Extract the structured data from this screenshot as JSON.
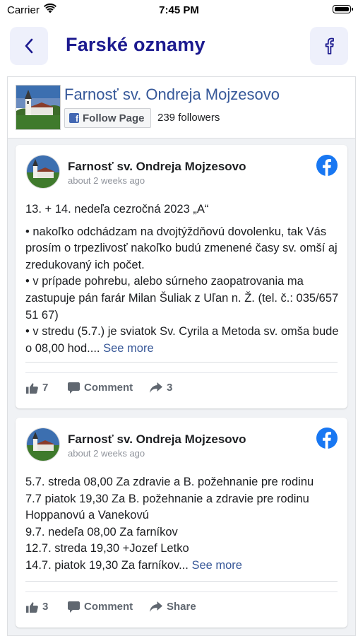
{
  "status_bar": {
    "carrier": "Carrier",
    "time": "7:45 PM"
  },
  "nav": {
    "title": "Farské oznamy",
    "back_icon": "chevron-left-icon",
    "fb_icon": "facebook-icon"
  },
  "page": {
    "name": "Farnosť sv. Ondreja Mojzesovo",
    "follow_label": "Follow Page",
    "followers": "239 followers"
  },
  "posts": [
    {
      "author": "Farnosť sv. Ondreja Mojzesovo",
      "time": "about 2 weeks ago",
      "lines": [
        "13. + 14. nedeľa cezročná 2023 „A“",
        "• nakoľko odchádzam na dvojtýždňovú dovolenku, tak Vás prosím o trpezlivosť nakoľko budú zmenené časy sv. omší aj zredukovaný ich počet.",
        "• v prípade pohrebu, alebo súrneho zaopatrovania ma zastupuje pán farár Milan Šuliak z Uľan n. Ž. (tel. č.: 035/657 51 67)",
        "• v stredu (5.7.) je sviatok Sv. Cyrila a Metoda sv. omša bude o 08,00 hod...."
      ],
      "see_more": "See more",
      "likes": "7",
      "comment_label": "Comment",
      "shares": "3"
    },
    {
      "author": "Farnosť sv. Ondreja Mojzesovo",
      "time": "about 2 weeks ago",
      "lines": [
        "5.7. streda 08,00 Za zdravie a B. požehnanie pre rodinu",
        "7.7 piatok 19,30 Za B. požehnanie a zdravie pre rodinu Hoppanovú a Vanekovú",
        "9.7. nedeľa 08,00 Za farníkov",
        "12.7. streda 19,30 +Jozef Letko",
        "14.7. piatok 19,30 Za farníkov..."
      ],
      "see_more": "See more",
      "likes": "3",
      "comment_label": "Comment",
      "share_label": "Share"
    }
  ],
  "colors": {
    "nav_title": "#1c1a8f",
    "nav_button_bg": "#eef0fb",
    "fb_blue": "#1877f2",
    "page_link": "#365899"
  }
}
